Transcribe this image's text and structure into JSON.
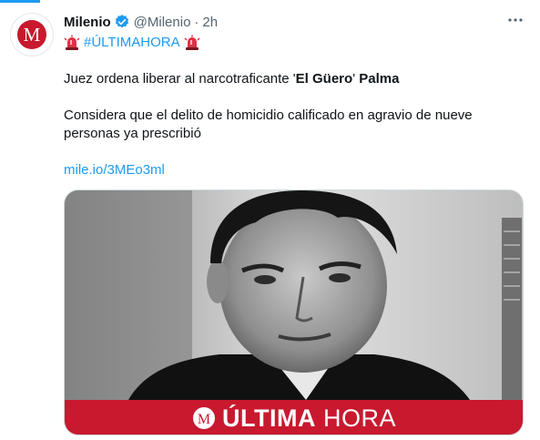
{
  "tweet": {
    "author_name": "Milenio",
    "handle": "@Milenio",
    "separator": "·",
    "time": "2h",
    "hashtag": "#ÚLTIMAHORA",
    "line2_pre": "Juez ordena liberar al narcotraficante '",
    "line2_bold1": "El Güero",
    "line2_mid": "' ",
    "line2_bold2": "Palma",
    "line3": "Considera que el delito de homicidio calificado en agravio de nueve personas ya prescribió",
    "link": "mile.io/3MEo3ml"
  },
  "card": {
    "banner_strong": "ÚLTIMA",
    "banner_light": "HORA"
  },
  "colors": {
    "accent": "#1d9bf0",
    "brand_red": "#c8192e",
    "muted": "#536471"
  },
  "icons": [
    "milenio-logo-icon",
    "verified-badge-icon",
    "more-options-icon",
    "siren-icon"
  ]
}
